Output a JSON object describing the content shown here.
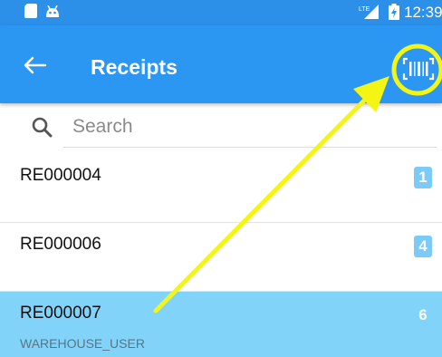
{
  "status_bar": {
    "time": "12:39",
    "network": "LTE",
    "icons": [
      "sd-card-icon",
      "android-icon",
      "lte-signal-icon",
      "battery-charging-icon"
    ]
  },
  "app_bar": {
    "title": "Receipts",
    "back_icon": "arrow-left-icon",
    "scan_icon": "barcode-scan-icon",
    "color": "#2c96f3"
  },
  "search": {
    "placeholder": "Search",
    "icon": "search-icon"
  },
  "receipts": [
    {
      "id": "RE000004",
      "count": "1",
      "user": "",
      "selected": false
    },
    {
      "id": "RE000006",
      "count": "4",
      "user": "",
      "selected": false
    },
    {
      "id": "RE000007",
      "count": "6",
      "user": "WAREHOUSE_USER",
      "selected": true
    }
  ],
  "annotation": {
    "type": "arrow-pointing-to-scan-button",
    "color": "#f5f514"
  }
}
